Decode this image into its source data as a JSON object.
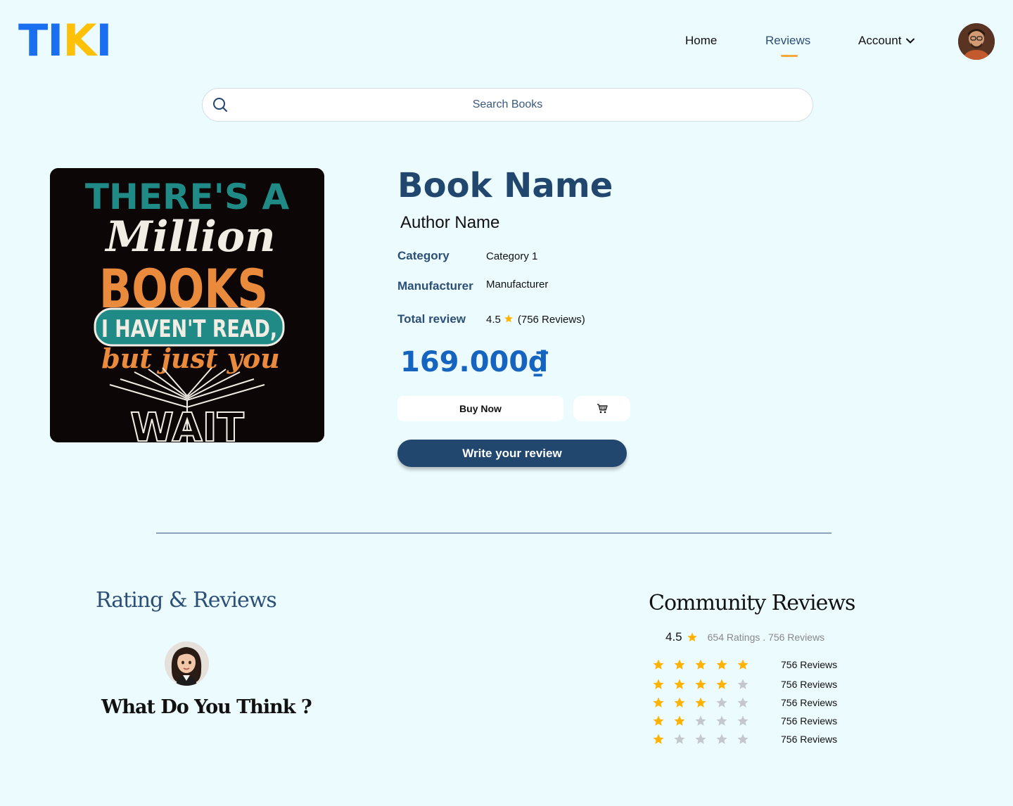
{
  "brand": {
    "logo_text_a": "TI",
    "logo_text_k": "K",
    "logo_text_b": "I"
  },
  "nav": {
    "home": "Home",
    "reviews": "Reviews",
    "account": "Account"
  },
  "search": {
    "placeholder": "Search Books"
  },
  "book": {
    "title": "Book Name",
    "author": "Author Name",
    "category_label": "Category",
    "category_value": "Category 1",
    "manufacturer_label": "Manufacturer",
    "manufacturer_value": "Manufacturer",
    "total_review_label": "Total review",
    "rating": "4.5",
    "review_count": "(756 Reviews)",
    "price": "169.000₫",
    "cover": {
      "line1": "THERE'S A",
      "line2": "Million",
      "line3": "BOOKS",
      "line4": "I HAVEN'T READ,",
      "line5": "but just you",
      "line6": "WAIT"
    }
  },
  "actions": {
    "buy_now": "Buy Now",
    "write_review": "Write your review"
  },
  "rating_section": {
    "title": "Rating & Reviews",
    "prompt": "What Do You Think ?"
  },
  "community": {
    "title": "Community Reviews",
    "average": "4.5",
    "meta": "654 Ratings . 756 Reviews",
    "rows": [
      {
        "stars": 5,
        "count": "756 Reviews"
      },
      {
        "stars": 4,
        "count": "756 Reviews"
      },
      {
        "stars": 3,
        "count": "756 Reviews"
      },
      {
        "stars": 2,
        "count": "756 Reviews"
      },
      {
        "stars": 1,
        "count": "756 Reviews"
      }
    ]
  },
  "colors": {
    "background": "#ecfbfe",
    "brand_blue": "#1a6ff0",
    "brand_yellow": "#ffc107",
    "navy": "#22476e",
    "price_blue": "#1565c0",
    "star": "#ffb300",
    "star_empty": "#c4c8cc"
  }
}
